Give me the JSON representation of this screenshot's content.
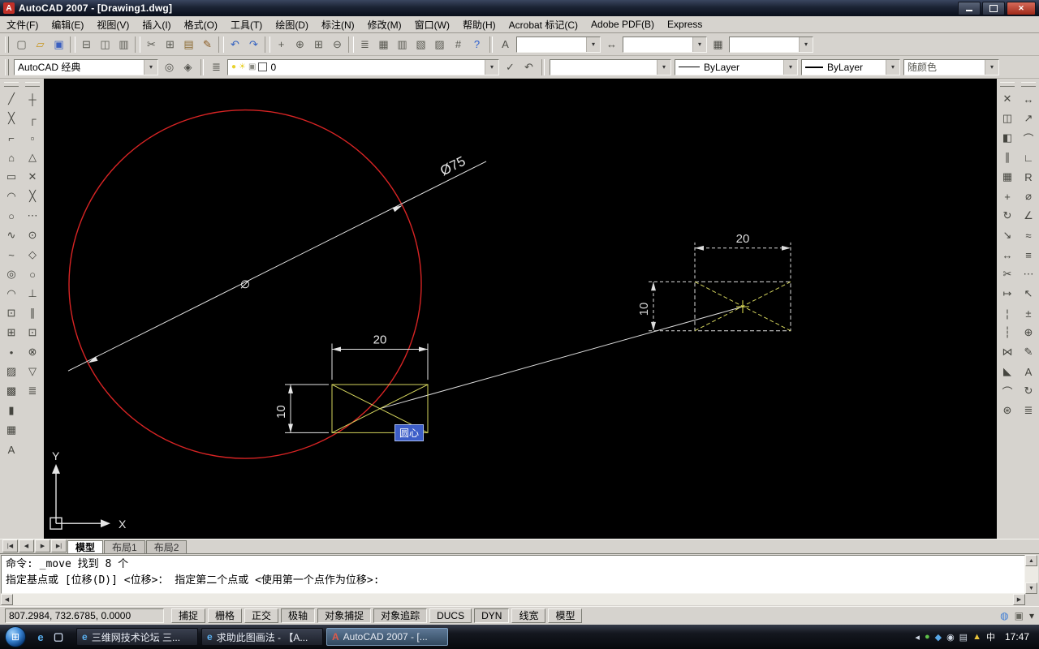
{
  "window": {
    "title": "AutoCAD 2007 - [Drawing1.dwg]",
    "icon_letter": "A",
    "close_glyph": "✕"
  },
  "ui": {
    "dropdown_arrow": "▾",
    "arrow_up": "▲",
    "arrow_down": "▼",
    "arrow_left": "◀",
    "arrow_right": "▶"
  },
  "menu": {
    "items": [
      "文件(F)",
      "编辑(E)",
      "视图(V)",
      "插入(I)",
      "格式(O)",
      "工具(T)",
      "绘图(D)",
      "标注(N)",
      "修改(M)",
      "窗口(W)",
      "帮助(H)",
      "Acrobat 标记(C)",
      "Adobe PDF(B)",
      "Express"
    ]
  },
  "toolbar_row1": {
    "icons": [
      {
        "name": "new-file-icon",
        "glyph": "▢",
        "color": "#5a5a52"
      },
      {
        "name": "open-file-icon",
        "glyph": "▱",
        "color": "#c79520"
      },
      {
        "name": "save-icon",
        "glyph": "▣",
        "color": "#3a5fc0"
      },
      {
        "name": "separator",
        "glyph": "",
        "sep": true
      },
      {
        "name": "plot-icon",
        "glyph": "⊟",
        "color": "#5a5a52"
      },
      {
        "name": "plot-preview-icon",
        "glyph": "◫",
        "color": "#5a5a52"
      },
      {
        "name": "publish-icon",
        "glyph": "▥",
        "color": "#5a5a52"
      },
      {
        "name": "separator",
        "glyph": "",
        "sep": true
      },
      {
        "name": "cut-icon",
        "glyph": "✂",
        "color": "#5a5a52"
      },
      {
        "name": "copy-icon",
        "glyph": "⊞",
        "color": "#5a5a52"
      },
      {
        "name": "paste-icon",
        "glyph": "▤",
        "color": "#8a6a30"
      },
      {
        "name": "match-properties-icon",
        "glyph": "✎",
        "color": "#8a5a20"
      },
      {
        "name": "separator",
        "glyph": "",
        "sep": true
      },
      {
        "name": "undo-icon",
        "glyph": "↶",
        "color": "#2f5fc0"
      },
      {
        "name": "redo-icon",
        "glyph": "↷",
        "color": "#2f5fc0"
      },
      {
        "name": "separator",
        "glyph": "",
        "sep": true
      },
      {
        "name": "pan-icon",
        "glyph": "+",
        "color": "#5a5a52"
      },
      {
        "name": "zoom-realtime-icon",
        "glyph": "⊕",
        "color": "#5a5a52"
      },
      {
        "name": "zoom-window-icon",
        "glyph": "⊞",
        "color": "#5a5a52"
      },
      {
        "name": "zoom-previous-icon",
        "glyph": "⊖",
        "color": "#5a5a52"
      },
      {
        "name": "separator",
        "glyph": "",
        "sep": true
      },
      {
        "name": "properties-icon",
        "glyph": "≣",
        "color": "#5a5a52"
      },
      {
        "name": "designcenter-icon",
        "glyph": "▦",
        "color": "#5a5a52"
      },
      {
        "name": "tool-palettes-icon",
        "glyph": "▥",
        "color": "#5a5a52"
      },
      {
        "name": "sheet-set-manager-icon",
        "glyph": "▧",
        "color": "#5a5a52"
      },
      {
        "name": "markup-set-manager-icon",
        "glyph": "▨",
        "color": "#5a5a52"
      },
      {
        "name": "quickcalc-icon",
        "glyph": "#",
        "color": "#5a5a52"
      },
      {
        "name": "help-icon",
        "glyph": "?",
        "color": "#2b5fd0"
      }
    ],
    "text_style_glyph": "A",
    "dim_style_glyph": "↔",
    "table_style_glyph": "▦",
    "text_style_value": "",
    "dim_style_value": "",
    "table_style_value": ""
  },
  "toolbar_row2": {
    "workspace_value": "AutoCAD 经典",
    "workspace_settings_glyph": "◎",
    "workspace_lock_glyph": "◈",
    "layer_properties_glyph": "≣",
    "layer_bulb_glyph": "●",
    "layer_sun_glyph": "☀",
    "layer_lock_glyph": "▣",
    "layer_name": "0",
    "make_current_glyph": "✓",
    "layer_previous_glyph": "↶",
    "color_value": "",
    "linetype_value": "ByLayer",
    "lineweight_value": "ByLayer",
    "plotstyle_value": "随颜色"
  },
  "left_toolbar": {
    "draw": [
      {
        "name": "line-icon",
        "glyph": "╱"
      },
      {
        "name": "construction-line-icon",
        "glyph": "╳"
      },
      {
        "name": "polyline-icon",
        "glyph": "⌐"
      },
      {
        "name": "polygon-icon",
        "glyph": "⌂"
      },
      {
        "name": "rectangle-icon",
        "glyph": "▭"
      },
      {
        "name": "arc-icon",
        "glyph": "◠"
      },
      {
        "name": "circle-icon",
        "glyph": "○"
      },
      {
        "name": "revision-cloud-icon",
        "glyph": "∿"
      },
      {
        "name": "spline-icon",
        "glyph": "~"
      },
      {
        "name": "ellipse-icon",
        "glyph": "◎"
      },
      {
        "name": "ellipse-arc-icon",
        "glyph": "◠"
      },
      {
        "name": "insert-block-icon",
        "glyph": "⊡"
      },
      {
        "name": "make-block-icon",
        "glyph": "⊞"
      },
      {
        "name": "point-icon",
        "glyph": "•"
      },
      {
        "name": "hatch-icon",
        "glyph": "▨"
      },
      {
        "name": "gradient-icon",
        "glyph": "▩"
      },
      {
        "name": "region-icon",
        "glyph": "▮"
      },
      {
        "name": "table-icon",
        "glyph": "▦"
      },
      {
        "name": "mtext-icon",
        "glyph": "A"
      }
    ],
    "osnap": [
      {
        "name": "temporary-track-point-icon",
        "glyph": "┼"
      },
      {
        "name": "snap-from-icon",
        "glyph": "┌"
      },
      {
        "name": "endpoint-snap-icon",
        "glyph": "▫"
      },
      {
        "name": "midpoint-snap-icon",
        "glyph": "△"
      },
      {
        "name": "intersection-snap-icon",
        "glyph": "✕"
      },
      {
        "name": "apparent-intersection-snap-icon",
        "glyph": "╳"
      },
      {
        "name": "extension-snap-icon",
        "glyph": "⋯"
      },
      {
        "name": "center-snap-icon",
        "glyph": "⊙"
      },
      {
        "name": "quadrant-snap-icon",
        "glyph": "◇"
      },
      {
        "name": "tangent-snap-icon",
        "glyph": "○"
      },
      {
        "name": "perpendicular-snap-icon",
        "glyph": "⊥"
      },
      {
        "name": "parallel-snap-icon",
        "glyph": "∥"
      },
      {
        "name": "insert-snap-icon",
        "glyph": "⊡"
      },
      {
        "name": "node-snap-icon",
        "glyph": "⊗"
      },
      {
        "name": "nearest-snap-icon",
        "glyph": "▽"
      },
      {
        "name": "osnap-settings-icon",
        "glyph": "≣"
      }
    ]
  },
  "right_toolbar": {
    "modify": [
      {
        "name": "erase-icon",
        "glyph": "✕"
      },
      {
        "name": "copy-object-icon",
        "glyph": "◫"
      },
      {
        "name": "mirror-icon",
        "glyph": "◧"
      },
      {
        "name": "offset-icon",
        "glyph": "∥"
      },
      {
        "name": "array-icon",
        "glyph": "▦"
      },
      {
        "name": "move-icon",
        "glyph": "+"
      },
      {
        "name": "rotate-icon",
        "glyph": "↻"
      },
      {
        "name": "scale-icon",
        "glyph": "↘"
      },
      {
        "name": "stretch-icon",
        "glyph": "↔"
      },
      {
        "name": "trim-icon",
        "glyph": "✂"
      },
      {
        "name": "extend-icon",
        "glyph": "↦"
      },
      {
        "name": "break-at-point-icon",
        "glyph": "¦"
      },
      {
        "name": "break-icon",
        "glyph": "┆"
      },
      {
        "name": "join-icon",
        "glyph": "⋈"
      },
      {
        "name": "chamfer-icon",
        "glyph": "◣"
      },
      {
        "name": "fillet-icon",
        "glyph": "⌒"
      },
      {
        "name": "explode-icon",
        "glyph": "⊛"
      }
    ],
    "dimension": [
      {
        "name": "linear-dimension-icon",
        "glyph": "↔"
      },
      {
        "name": "aligned-dimension-icon",
        "glyph": "↗"
      },
      {
        "name": "arc-length-dimension-icon",
        "glyph": "⌒"
      },
      {
        "name": "ordinate-dimension-icon",
        "glyph": "∟"
      },
      {
        "name": "radius-dimension-icon",
        "glyph": "R"
      },
      {
        "name": "diameter-dimension-icon",
        "glyph": "⌀"
      },
      {
        "name": "angular-dimension-icon",
        "glyph": "∠"
      },
      {
        "name": "quick-dimension-icon",
        "glyph": "≈"
      },
      {
        "name": "baseline-dimension-icon",
        "glyph": "≡"
      },
      {
        "name": "continue-dimension-icon",
        "glyph": "⋯"
      },
      {
        "name": "quick-leader-icon",
        "glyph": "↖"
      },
      {
        "name": "tolerance-icon",
        "glyph": "±"
      },
      {
        "name": "center-mark-icon",
        "glyph": "⊕"
      },
      {
        "name": "dimension-edit-icon",
        "glyph": "✎"
      },
      {
        "name": "dimension-text-edit-icon",
        "glyph": "A"
      },
      {
        "name": "dimension-update-icon",
        "glyph": "↻"
      },
      {
        "name": "dimension-style-icon",
        "glyph": "≣"
      }
    ]
  },
  "canvas": {
    "diameter_label": "Ø75",
    "rect_width_label": "20",
    "rect_height_label": "10",
    "preview_width_label": "20",
    "preview_height_label": "10",
    "tooltip": "圆心",
    "ucs_x_label": "X",
    "ucs_y_label": "Y",
    "entity_color_red": "#d82424",
    "entity_color_yellow": "#d6d65e",
    "entity_color_white": "#e6e6e6"
  },
  "tabs": {
    "nav": [
      {
        "name": "first-tab-button",
        "glyph": "|◀"
      },
      {
        "name": "prev-tab-button",
        "glyph": "◀"
      },
      {
        "name": "next-tab-button",
        "glyph": "▶"
      },
      {
        "name": "last-tab-button",
        "glyph": "▶|"
      }
    ],
    "items": [
      {
        "name": "tab-model",
        "label": "模型",
        "active": true
      },
      {
        "name": "tab-layout1",
        "label": "布局1",
        "active": false
      },
      {
        "name": "tab-layout2",
        "label": "布局2",
        "active": false
      }
    ]
  },
  "command": {
    "line1": "命令: _move 找到 8 个",
    "line2": "指定基点或 [位移(D)] <位移>：  指定第二个点或 <使用第一个点作为位移>:"
  },
  "status": {
    "coords": "807.2984, 732.6785, 0.0000",
    "buttons": [
      {
        "name": "snap-toggle",
        "label": "捕捉",
        "pressed": false
      },
      {
        "name": "grid-toggle",
        "label": "栅格",
        "pressed": false
      },
      {
        "name": "ortho-toggle",
        "label": "正交",
        "pressed": false
      },
      {
        "name": "polar-toggle",
        "label": "极轴",
        "pressed": true
      },
      {
        "name": "osnap-toggle",
        "label": "对象捕捉",
        "pressed": true
      },
      {
        "name": "otrack-toggle",
        "label": "对象追踪",
        "pressed": true
      },
      {
        "name": "ducs-toggle",
        "label": "DUCS",
        "pressed": false
      },
      {
        "name": "dyn-toggle",
        "label": "DYN",
        "pressed": true
      },
      {
        "name": "lineweight-toggle",
        "label": "线宽",
        "pressed": false
      },
      {
        "name": "model-toggle",
        "label": "模型",
        "pressed": false
      }
    ],
    "right_icons": [
      {
        "name": "communication-center-icon",
        "glyph": "◍",
        "color": "#3a7bd5"
      },
      {
        "name": "toolbar-lock-icon",
        "glyph": "▣",
        "color": "#6a6a62"
      },
      {
        "name": "status-menu-arrow-icon",
        "glyph": "▾",
        "color": "#3a3a34"
      }
    ]
  },
  "taskbar": {
    "start_glyph": "⊞",
    "quick_launch": [
      {
        "name": "ie-quick-launch-icon",
        "glyph": "e",
        "color": "#5ab0f0"
      },
      {
        "name": "show-desktop-icon",
        "glyph": "▢",
        "color": "#c8d4e8"
      }
    ],
    "buttons": [
      {
        "name": "task-ie-forum",
        "icon": "e",
        "icon_color": "#5ab0f0",
        "label": "三维网技术论坛 三...",
        "active": false
      },
      {
        "name": "task-ie-help",
        "icon": "e",
        "icon_color": "#5ab0f0",
        "label": "求助此图画法 - 【A...",
        "active": false
      },
      {
        "name": "task-autocad",
        "icon": "A",
        "icon_color": "#e05a4a",
        "label": "AutoCAD 2007 - [...",
        "active": true
      }
    ],
    "tray_icons": [
      {
        "name": "hide-tray-icons-arrow",
        "glyph": "◂",
        "color": "#d0d8e4"
      },
      {
        "name": "antivirus-tray-icon",
        "glyph": "●",
        "color": "#5fc24a"
      },
      {
        "name": "messenger-tray-icon",
        "glyph": "◆",
        "color": "#58a8e8"
      },
      {
        "name": "volume-tray-icon",
        "glyph": "◉",
        "color": "#d0d8e4"
      },
      {
        "name": "network-tray-icon",
        "glyph": "▤",
        "color": "#d0d8e4"
      },
      {
        "name": "security-center-tray-icon",
        "glyph": "▲",
        "color": "#e8c33a"
      },
      {
        "name": "input-method-tray-icon",
        "glyph": "中",
        "color": "#ffffff"
      }
    ],
    "clock": "17:47"
  }
}
